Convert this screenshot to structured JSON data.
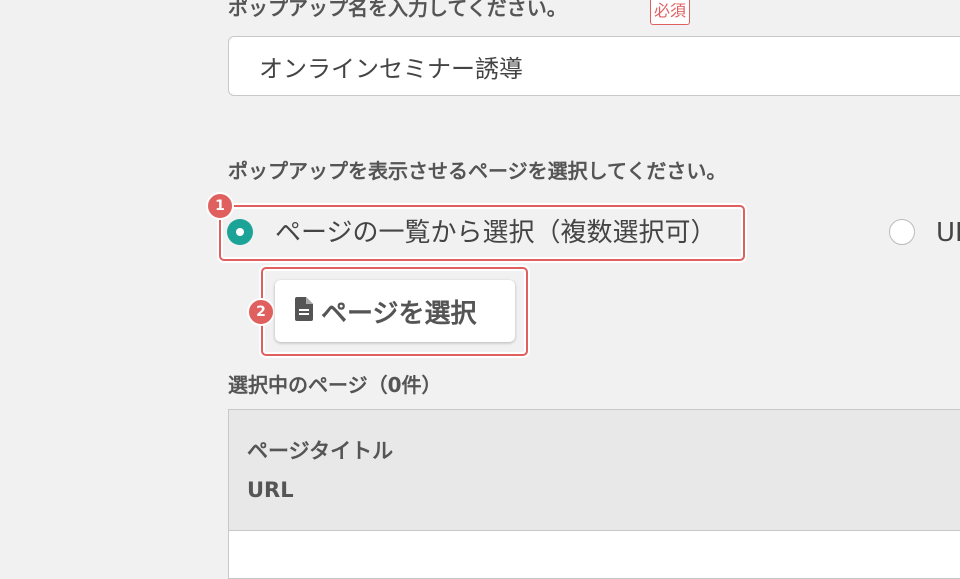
{
  "popup_name": {
    "label": "ポップアップ名を入力してください。",
    "required_badge": "必須",
    "value": "オンラインセミナー誘導"
  },
  "page_select": {
    "label": "ポップアップを表示させるページを選択してください。",
    "options": [
      {
        "label": "ページの一覧から選択（複数選択可）",
        "selected": true
      },
      {
        "label": "URL",
        "selected": false
      }
    ],
    "select_button_label": "ページを選択"
  },
  "selected_pages": {
    "label": "選択中のページ（0件）",
    "columns": [
      "ページタイトル",
      "URL"
    ],
    "rows": []
  },
  "annotations": {
    "step1": "1",
    "step2": "2"
  },
  "colors": {
    "accent": "#1aa396",
    "highlight": "#e06060"
  },
  "icons": {
    "select_button_icon": "document-icon"
  }
}
